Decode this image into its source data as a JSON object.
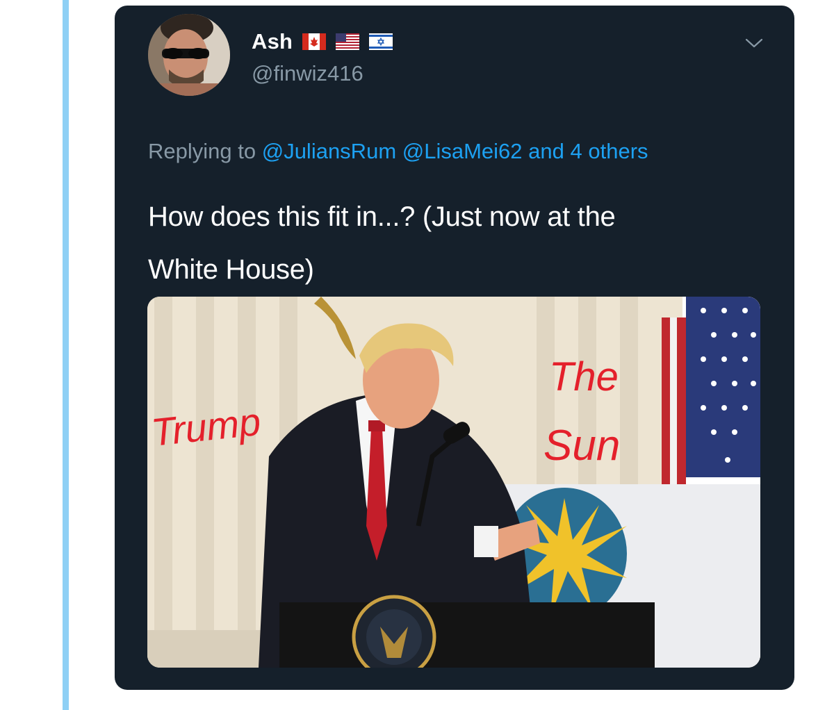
{
  "tweet": {
    "display_name": "Ash",
    "handle": "@finwiz416",
    "flags": [
      "canada-flag-icon",
      "usa-flag-icon",
      "israel-flag-icon"
    ],
    "reply": {
      "prefix": "Replying to",
      "mentions": [
        "@JuliansRum",
        "@LisaMei62"
      ],
      "others": "and 4 others"
    },
    "text_line1": "How does this fit in...? (Just now at the",
    "text_line2": "White House)",
    "image": {
      "annotations": {
        "left": "Trump",
        "right_line1": "The",
        "right_line2": "Sun"
      }
    }
  },
  "colors": {
    "card_background": "#15202b",
    "text_primary": "#ffffff",
    "text_secondary": "#8899a6",
    "link": "#1da1f2",
    "thread_line": "#8fd0f5",
    "annotation_red": "#e4202b"
  }
}
